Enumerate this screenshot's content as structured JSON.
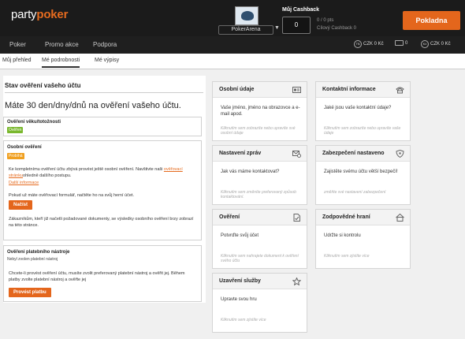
{
  "header": {
    "logo_part1": "party",
    "logo_part2": "poker",
    "alias": "PokerArena",
    "cashback_title": "Můj Cashback",
    "cashback_value": "0",
    "cashback_points": "0 / 0 pts",
    "cashback_target": "Cílový Cashback 0",
    "cashier_label": "Pokladna"
  },
  "nav": {
    "items": [
      "Poker",
      "Promo akce",
      "Podpora"
    ],
    "balances": [
      {
        "icon": "ts-coin-icon",
        "icon_text": "T$",
        "value": "CZK 0 Kč"
      },
      {
        "icon": "ticket-icon",
        "icon_text": "",
        "value": "0"
      },
      {
        "icon": "kc-coin-icon",
        "icon_text": "Kč",
        "value": "CZK 0 Kč"
      }
    ]
  },
  "tabs": [
    "Můj přehled",
    "Mé podrobnosti",
    "Mé výpisy"
  ],
  "main": {
    "title": "Stav ověření vašeho účtu",
    "headline": "Máte 30 den/dny/dnů na ověření vašeho účtu.",
    "age": {
      "title": "Ověření věku/totožnosti",
      "badge": "Ověřen"
    },
    "personal": {
      "title": "Osobní ověření",
      "badge": "Probíhá",
      "p1": "Ke kompletnímu ověření účtu zbývá provést ještě osobní ověření. Navštivte naši",
      "p1_link": "ověřovací stránku",
      "p1_rest": "ohledně dalšího postupu.",
      "more_link": "Další informace",
      "p2": "Pokud už máte ověřovací formulář, načtěte ho na svůj herní účet.",
      "load_button": "Načíst",
      "p3": "Zákazníkům, kteří již načetli požadované dokumenty, se výsledky osobního ověření brzy zobrazí na této stránce."
    },
    "payment": {
      "title": "Ověření platebního nástroje",
      "subtitle": "Nebyl zvolen platební nástroj",
      "text": "Chcete-li provést ověření účtu, musíte zvolit preferovaný platební nástroj a ověřit jej. Během platby zvolte platební nástroj a ověřte jej",
      "button": "Provést platbu"
    }
  },
  "cards": [
    {
      "title": "Osobní údaje",
      "icon": "id-card-icon",
      "text": "Vaše jméno, jméno na obrazovce a e-mail apod.",
      "note": "Kliknutím sem zobrazíte nebo upravíte své osobní údaje"
    },
    {
      "title": "Kontaktní informace",
      "icon": "phone-icon",
      "text": "Jaké jsou vaše kontaktní údaje?",
      "note": "Kliknutím sem zobrazíte nebo upravíte vaše údaje"
    },
    {
      "title": "Nastavení zpráv",
      "icon": "message-settings-icon",
      "text": "Jak vás máme kontaktovat?",
      "note": "Kliknutím sem změníte preferovaný způsob kontaktování."
    },
    {
      "title": "Zabezpečení nastaveno",
      "icon": "shield-icon",
      "text": "Zajistěte svému účtu větší bezpečí!",
      "note": "změňte své nastavení zabezpečení"
    },
    {
      "title": "Ověření",
      "icon": "document-check-icon",
      "text": "Potvrďte svůj účet",
      "note": "Kliknutím sem nahrajete dokument k ověření svého účtu"
    },
    {
      "title": "Zodpovědné hraní",
      "icon": "home-icon",
      "text": "Udržte si kontrolu",
      "note": "Kliknutím sem zjistíte více"
    },
    {
      "title": "Uzavření služby",
      "icon": "star-icon",
      "text": "Upravte svou hru",
      "note": "Kliknutím sem zjistíte více"
    }
  ],
  "colors": {
    "accent": "#e4661c",
    "verified": "#7ab82e",
    "pending": "#f0a020",
    "header_bg": "#1b1b1b"
  }
}
